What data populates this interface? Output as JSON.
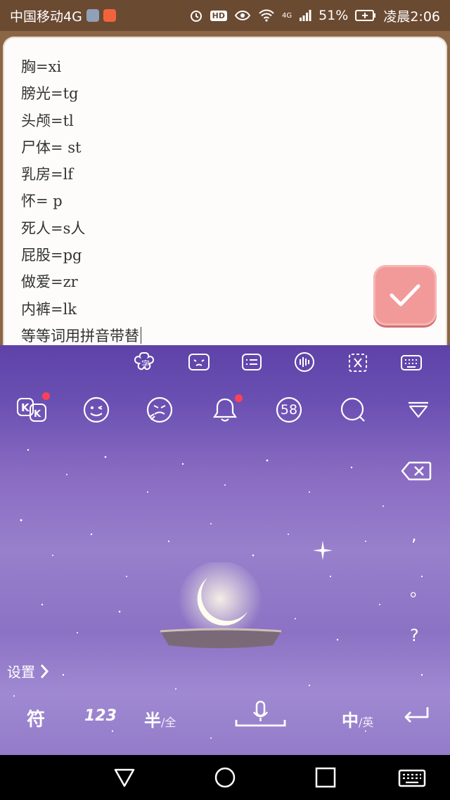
{
  "status_bar": {
    "carrier": "中国移动4G",
    "hd": "HD",
    "network": "4G",
    "battery_percent": "51%",
    "time": "凌晨2:06"
  },
  "note": {
    "lines": [
      "胸=xi",
      "膀光=tg",
      "头颅=tl",
      "尸体= st",
      "乳房=lf",
      "怀= p",
      "死人=s人",
      "屁股=pg",
      "做爱=zr",
      "内裤=lk",
      "等等词用拼音带替"
    ],
    "confirm_icon": "check-icon",
    "confirm_color": "#f29a9a"
  },
  "keyboard": {
    "toolbar_top": [
      "font-style-icon",
      "emoticon-icon",
      "clipboard-list-icon",
      "voice-icon",
      "crop-icon",
      "keyboard-icon"
    ],
    "toolbar_main": [
      "kk-skin-icon",
      "emoji-icon",
      "face-icon",
      "bell-icon",
      "58",
      "search-icon",
      "collapse-icon"
    ],
    "punctuation": [
      ",",
      "。",
      "?"
    ],
    "settings_label": "设置",
    "symbol_key": "符",
    "number_key": "123",
    "half_label": "半",
    "full_label": "/全",
    "chinese_label": "中",
    "english_label": "/英",
    "theme_color": "#8a6cc2",
    "badge_color": "#ff4057"
  },
  "nav_bar": {
    "back": "back-triangle-icon",
    "home": "home-circle-icon",
    "recents": "recents-square-icon",
    "keyboard": "keyboard-toggle-icon"
  }
}
